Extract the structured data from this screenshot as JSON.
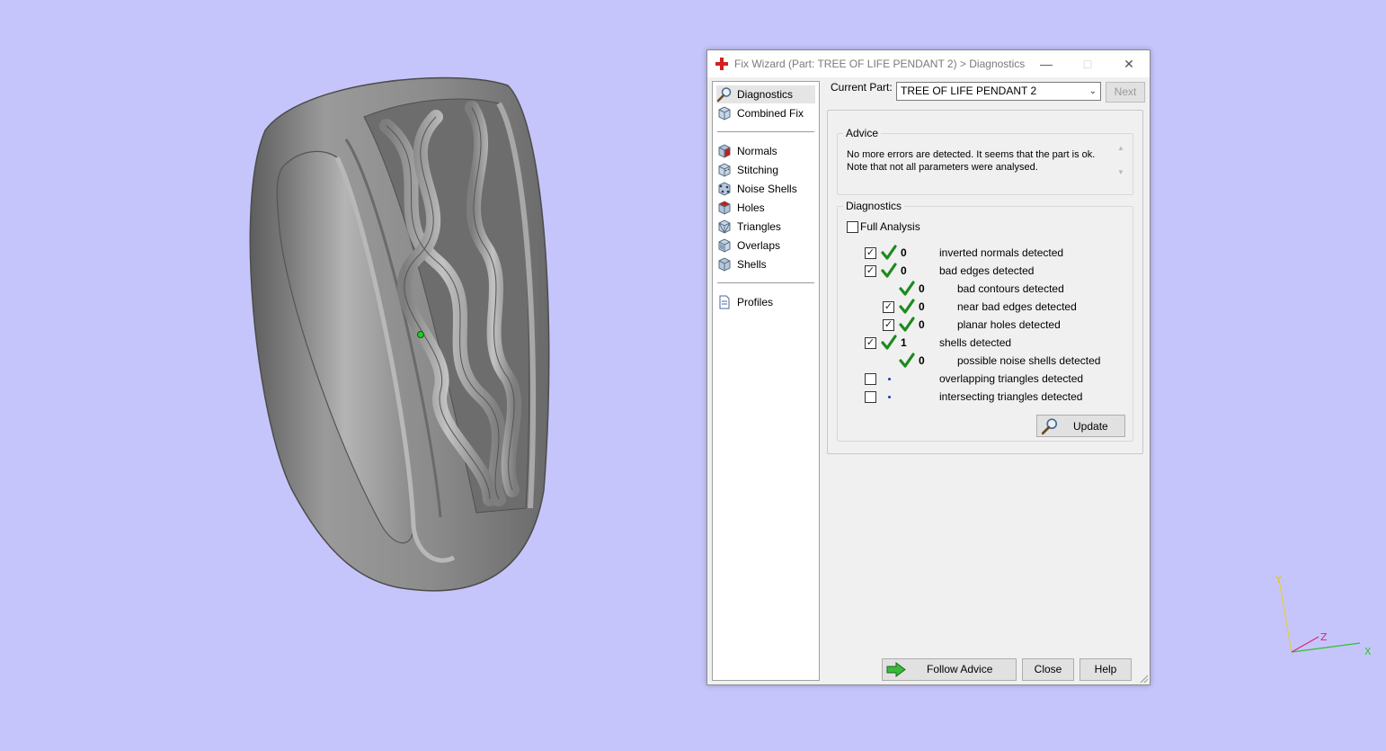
{
  "window": {
    "title": "Fix Wizard (Part: TREE OF LIFE PENDANT 2) > Diagnostics",
    "controls": [
      "minimize-icon",
      "maximize-icon",
      "close-icon"
    ]
  },
  "nav": {
    "items": [
      {
        "label": "Diagnostics",
        "icon": "magnifier-icon",
        "selected": true
      },
      {
        "label": "Combined Fix",
        "icon": "cube-icon"
      },
      {
        "label": "Normals",
        "icon": "normals-cube-icon"
      },
      {
        "label": "Stitching",
        "icon": "stitching-cube-icon"
      },
      {
        "label": "Noise Shells",
        "icon": "noise-shells-icon"
      },
      {
        "label": "Holes",
        "icon": "holes-cube-icon"
      },
      {
        "label": "Triangles",
        "icon": "triangles-cube-icon"
      },
      {
        "label": "Overlaps",
        "icon": "overlaps-cube-icon"
      },
      {
        "label": "Shells",
        "icon": "shells-cube-icon"
      },
      {
        "label": "Profiles",
        "icon": "document-icon"
      }
    ]
  },
  "header": {
    "current_part_label": "Current Part:",
    "current_part_value": "TREE OF LIFE PENDANT 2",
    "next_label": "Next"
  },
  "advice": {
    "title": "Advice",
    "line1": "No more errors are detected. It seems that the part is ok.",
    "line2": "Note that not all parameters were analysed."
  },
  "diagnostics": {
    "title": "Diagnostics",
    "full_analysis_label": "Full Analysis",
    "full_analysis_checked": false,
    "rows": [
      {
        "count": "0",
        "label": "inverted normals detected",
        "checked": true,
        "status": "ok"
      },
      {
        "count": "0",
        "label": "bad edges detected",
        "checked": true,
        "status": "ok"
      },
      {
        "count": "0",
        "label": "bad contours detected",
        "checked": null,
        "status": "ok"
      },
      {
        "count": "0",
        "label": "near bad edges detected",
        "checked": true,
        "status": "ok"
      },
      {
        "count": "0",
        "label": "planar holes detected",
        "checked": true,
        "status": "ok"
      },
      {
        "count": "1",
        "label": "shells detected",
        "checked": true,
        "status": "ok"
      },
      {
        "count": "0",
        "label": "possible noise shells detected",
        "checked": null,
        "status": "ok"
      },
      {
        "count": "",
        "label": "overlapping triangles detected",
        "checked": false,
        "status": "pending"
      },
      {
        "count": "",
        "label": "intersecting triangles detected",
        "checked": false,
        "status": "pending"
      }
    ],
    "update_label": "Update"
  },
  "footer": {
    "follow_advice_label": "Follow Advice",
    "close_label": "Close",
    "help_label": "Help"
  },
  "axes": {
    "x": "X",
    "y": "Y",
    "z": "Z"
  },
  "colors": {
    "background": "#c6c5fb",
    "check_green": "#1e8a1e",
    "axis_x": "#2ec22e",
    "axis_y": "#e0d040",
    "axis_z": "#d6247a"
  }
}
